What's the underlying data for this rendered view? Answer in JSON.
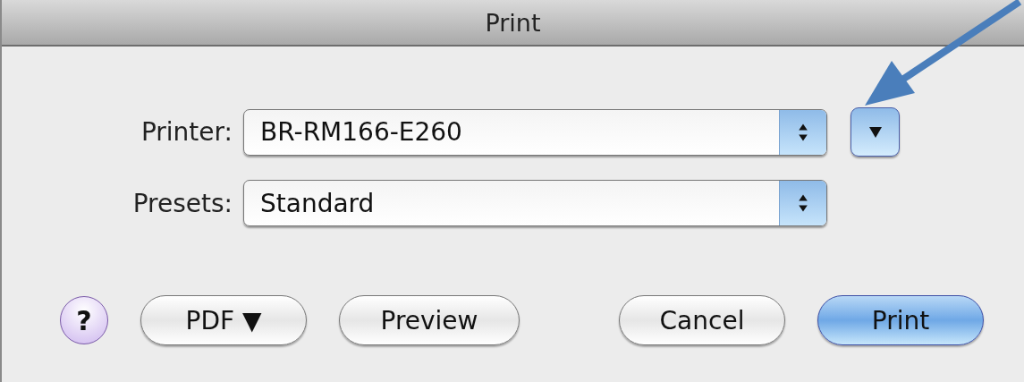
{
  "window": {
    "title": "Print"
  },
  "popups": [
    {
      "label": "Printer:",
      "value": "BR-RM166-E260",
      "disclosure": {
        "expanded": false
      }
    },
    {
      "label": "Presets:",
      "value": "Standard"
    }
  ],
  "help": {
    "label": "?"
  },
  "left_buttons": [
    {
      "label": "PDF ▼",
      "default": false
    },
    {
      "label": "Preview",
      "default": false
    }
  ],
  "right_buttons": [
    {
      "label": "Cancel",
      "default": false
    },
    {
      "label": "Print",
      "default": true
    }
  ]
}
